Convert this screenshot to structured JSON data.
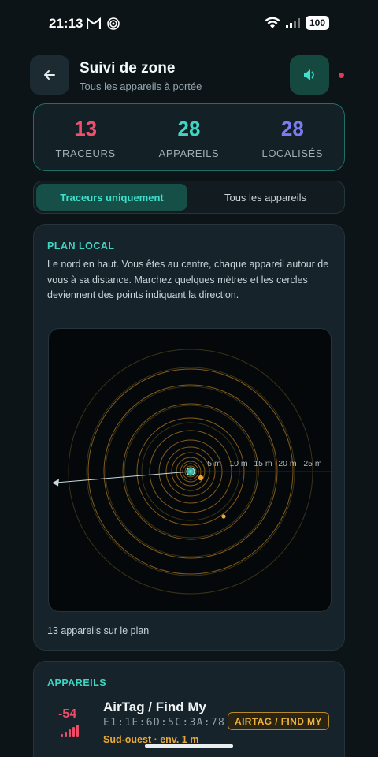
{
  "status_bar": {
    "time": "21:13",
    "battery": "100"
  },
  "header": {
    "title": "Suivi de zone",
    "subtitle": "Tous les appareils à portée"
  },
  "stats": [
    {
      "value": "13",
      "label": "TRACEURS",
      "color": "#f0506e"
    },
    {
      "value": "28",
      "label": "APPAREILS",
      "color": "#3fd5c3"
    },
    {
      "value": "28",
      "label": "LOCALISÉS",
      "color": "#7c7cf2"
    }
  ],
  "filter": {
    "active": "Traceurs uniquement",
    "inactive": "Tous les appareils"
  },
  "plan": {
    "heading": "PLAN LOCAL",
    "description": "Le nord en haut. Vous êtes au centre, chaque appareil autour de vous à sa distance. Marchez quelques mètres et les cercles deviennent des points indiquant la direction.",
    "ring_labels": [
      "5 m",
      "10 m",
      "15 m",
      "20 m",
      "25 m"
    ],
    "footer": "13 appareils sur le plan"
  },
  "devices": {
    "heading": "APPAREILS",
    "items": [
      {
        "rssi": "-54",
        "name": "AirTag / Find My",
        "mac": "E1:1E:6D:5C:3A:78",
        "location": "Sud-ouest · env. 1 m",
        "badge": "AIRTAG / FIND MY"
      }
    ]
  },
  "colors": {
    "accent": "#3fd5c3",
    "tracker": "#e7a93b",
    "alert": "#ef4a66"
  }
}
